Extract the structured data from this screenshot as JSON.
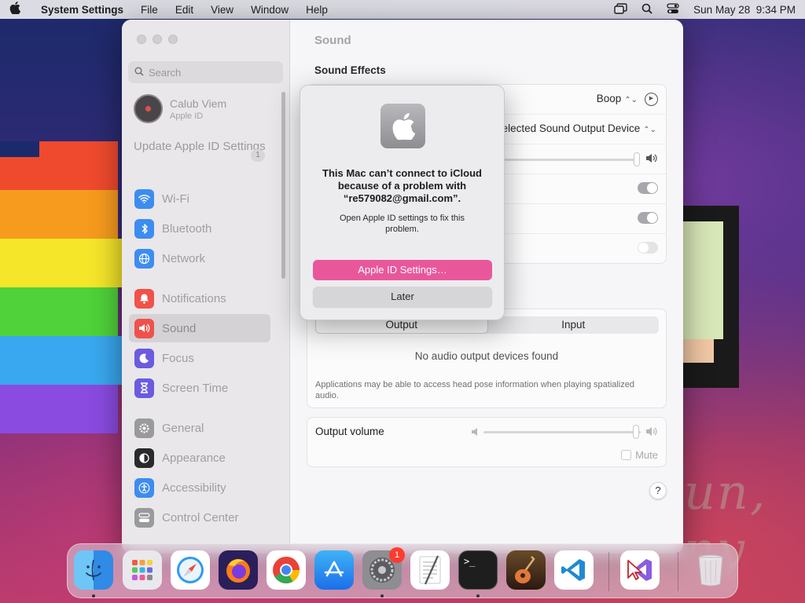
{
  "menubar": {
    "app_name": "System Settings",
    "menus": [
      "File",
      "Edit",
      "View",
      "Window",
      "Help"
    ],
    "datetime": "Sun May 28  9:34 PM"
  },
  "sidebar": {
    "search_placeholder": "Search",
    "profile": {
      "name": "Calub Viem",
      "subtitle": "Apple ID"
    },
    "update": {
      "label": "Update Apple ID Settings",
      "count": "1"
    },
    "items": [
      {
        "label": "Wi-Fi",
        "icon": "wifi-icon",
        "color": "#3d8cf0"
      },
      {
        "label": "Bluetooth",
        "icon": "bluetooth-icon",
        "color": "#3d8cf0"
      },
      {
        "label": "Network",
        "icon": "globe-icon",
        "color": "#3d8cf0"
      },
      {
        "label": "Notifications",
        "icon": "bell-icon",
        "color": "#f0514a"
      },
      {
        "label": "Sound",
        "icon": "speaker-icon",
        "color": "#f0514a"
      },
      {
        "label": "Focus",
        "icon": "moon-icon",
        "color": "#6a5be0"
      },
      {
        "label": "Screen Time",
        "icon": "hourglass-icon",
        "color": "#6a5be0"
      },
      {
        "label": "General",
        "icon": "gear-icon",
        "color": "#9a999d"
      },
      {
        "label": "Appearance",
        "icon": "appearance-icon",
        "color": "#2a2a2c"
      },
      {
        "label": "Accessibility",
        "icon": "accessibility-icon",
        "color": "#3d8cf0"
      },
      {
        "label": "Control Center",
        "icon": "control-center-icon",
        "color": "#9a999d"
      }
    ]
  },
  "content": {
    "pane_title": "Sound",
    "section_title": "Sound Effects",
    "alert_sound": "Boop",
    "output_device": "elected Sound Output Device",
    "tabs": [
      "Output",
      "Input"
    ],
    "no_devices": "No audio output devices found",
    "note": "Applications may be able to access head pose information when playing spatialized audio.",
    "output_volume_label": "Output volume",
    "mute_label": "Mute",
    "help": "?"
  },
  "dialog": {
    "title": "This Mac can’t connect to iCloud because of a problem with “re579082@gmail.com”.",
    "message": "Open Apple ID settings to fix this problem.",
    "primary_button": "Apple ID Settings…",
    "secondary_button": "Later"
  },
  "dock": {
    "settings_badge": "1",
    "terminal_prompt": ">_"
  },
  "wallpaper_text": "un, ny"
}
